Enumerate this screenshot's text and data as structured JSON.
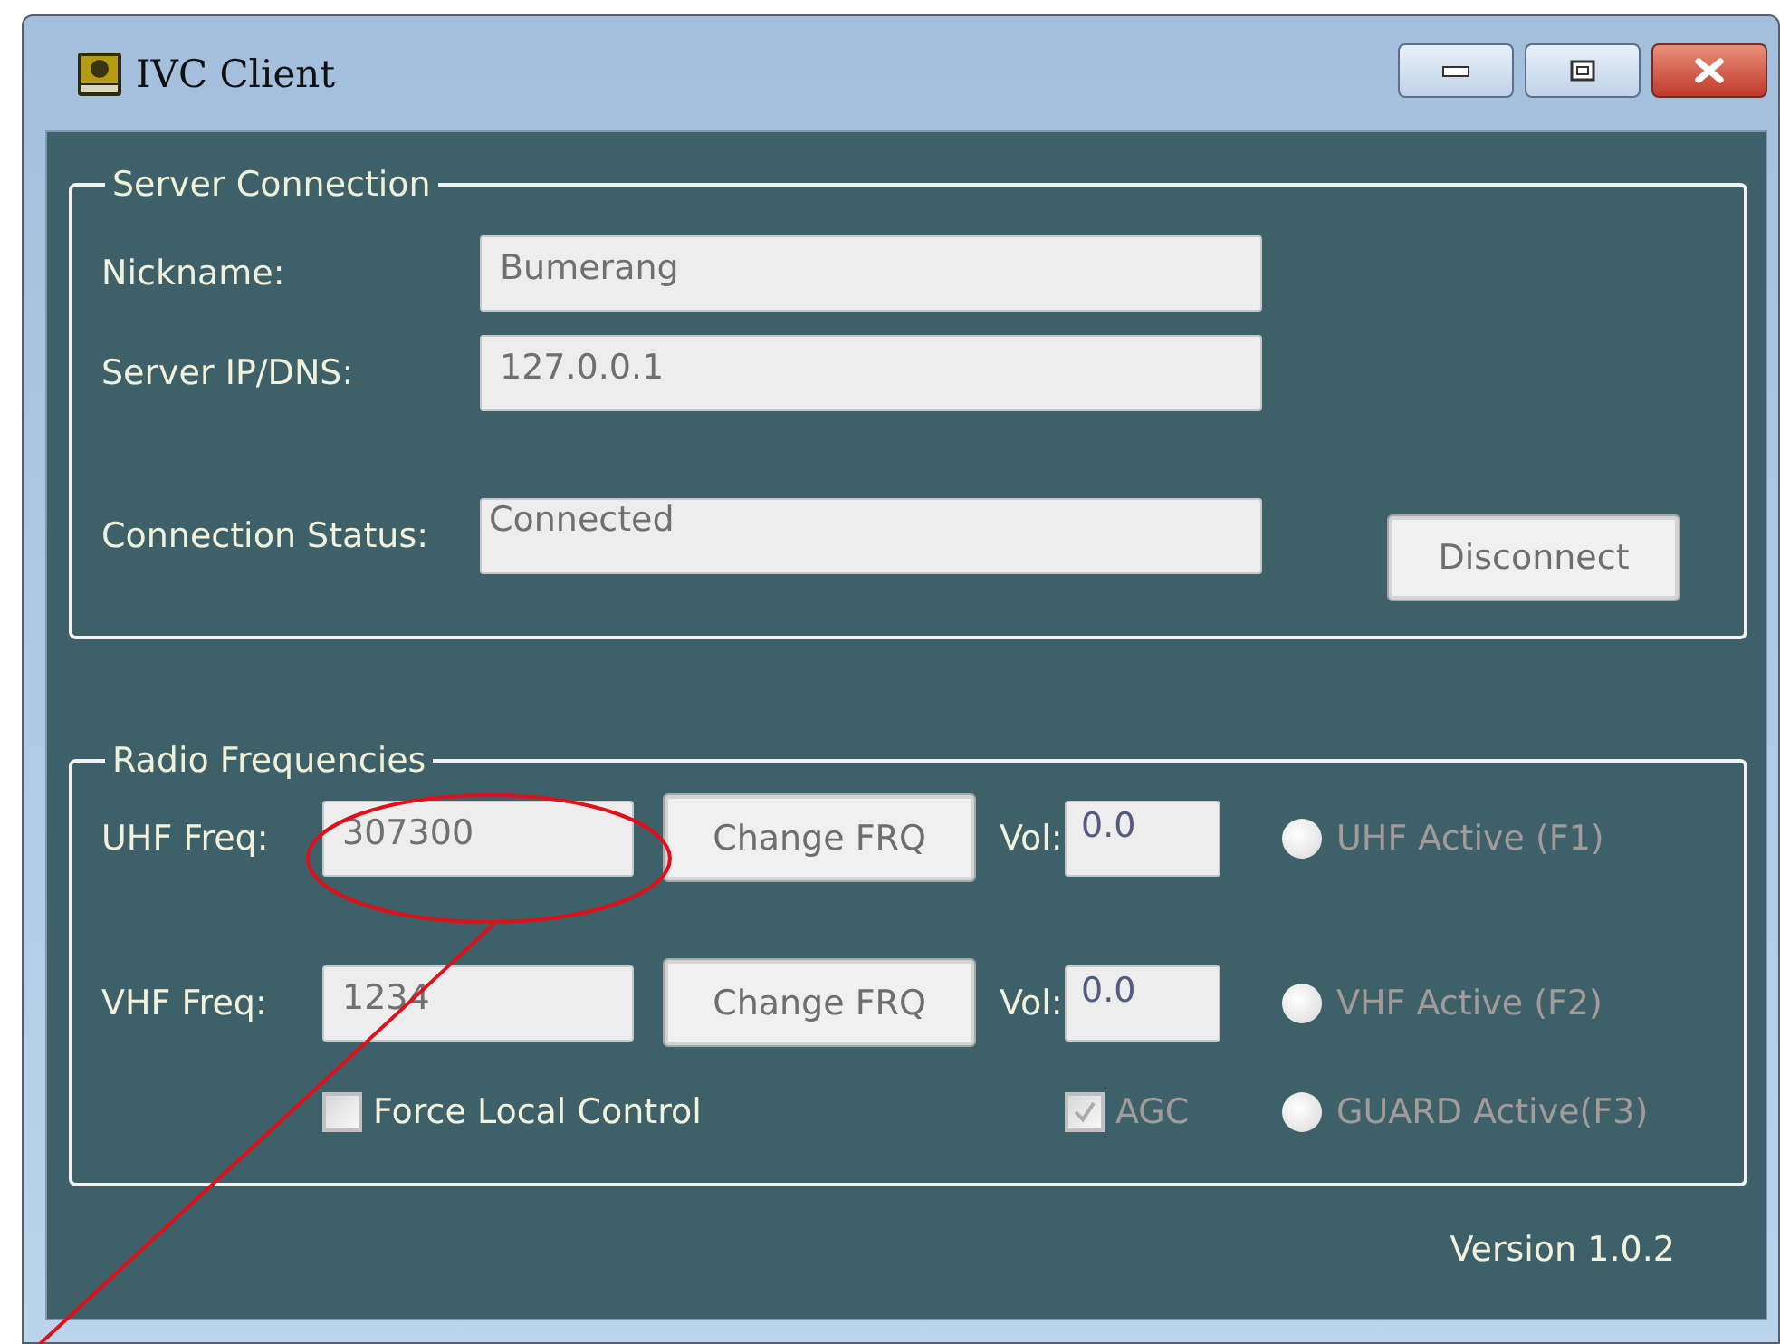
{
  "window": {
    "title": "IVC Client"
  },
  "server_connection": {
    "title": "Server Connection",
    "fields": [
      {
        "label": "Nickname:",
        "value": "Bumerang"
      },
      {
        "label": "Server IP/DNS:",
        "value": "127.0.0.1"
      },
      {
        "label": "Connection Status:",
        "value": "Connected"
      }
    ],
    "button": "Disconnect"
  },
  "radio_frequencies": {
    "title": "Radio Frequencies",
    "rows": [
      {
        "label": "UHF Freq:",
        "value": "307300",
        "button": "Change FRQ",
        "vol_label": "Vol:",
        "vol_value": "0.0",
        "radio": {
          "label": "UHF Active (F1)",
          "selected": false,
          "disabled": true
        }
      },
      {
        "label": "VHF Freq:",
        "value": "1234",
        "button": "Change FRQ",
        "vol_label": "Vol:",
        "vol_value": "0.0",
        "radio": {
          "label": "VHF Active (F2)",
          "selected": false,
          "disabled": true
        }
      }
    ],
    "force_local_control": {
      "label": "Force Local Control",
      "checked": false
    },
    "agc": {
      "label": "AGC",
      "checked": true,
      "disabled": true
    },
    "guard": {
      "label": "GUARD Active(F3)",
      "selected": false,
      "disabled": true
    }
  },
  "version": "Version 1.0.2"
}
